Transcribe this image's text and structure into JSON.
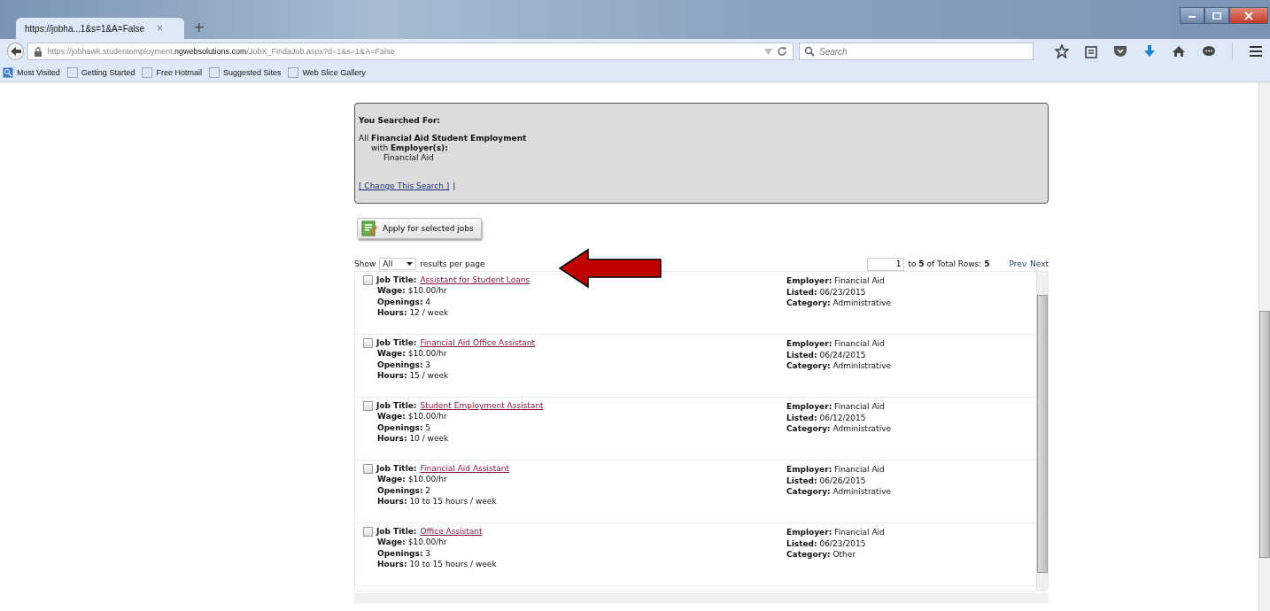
{
  "browser": {
    "tab_title": "https://jobha...1&s=1&A=False",
    "tab_close": "×",
    "new_tab": "+",
    "url": "https://jobhawk.studentemployment.**ngwebsolutions.com**/JobX_FindaJob.aspx?d=1&s=1&A=False",
    "search": {
      "placeholder": "Search"
    },
    "bookmarks": [
      "Most Visited",
      "Getting Started",
      "Free Hotmail",
      "Suggested Sites",
      "Web Slice Gallery"
    ]
  },
  "summary": {
    "heading": "You Searched For:",
    "line_1": "All **Financial Aid Student Employment**",
    "line_2": "with **Employer(s):**",
    "line_3": "Financial Aid",
    "change_link": "[ Change This Search ]",
    "separator": "|"
  },
  "apply_button": "Apply for selected jobs",
  "results_per_page": {
    "show": "Show",
    "value": "All",
    "suffix": "results per page"
  },
  "pager": {
    "start": "1",
    "range": "to **5** of Total Rows: **5**",
    "prev": "Prev",
    "next": "Next"
  },
  "jobs": [
    {
      "checked": false,
      "title_label": "Job Title:",
      "title": "Assistant for Student Loans",
      "left": [
        "**Wage:** $10.00/hr",
        "**Openings:** 4",
        "**Hours:** 12 / week"
      ],
      "right": [
        "**Employer:** Financial Aid",
        "**Listed:** 06/23/2015",
        "**Category:** Administrative"
      ]
    },
    {
      "checked": false,
      "title_label": "Job Title:",
      "title": "Financial Aid Office Assistant",
      "left": [
        "**Wage:** $10.00/hr",
        "**Openings:** 3",
        "**Hours:** 15 / week"
      ],
      "right": [
        "**Employer:** Financial Aid",
        "**Listed:** 06/24/2015",
        "**Category:** Administrative"
      ]
    },
    {
      "checked": false,
      "title_label": "Job Title:",
      "title": "Student Employment Assistant",
      "left": [
        "**Wage:** $10.00/hr",
        "**Openings:** 5",
        "**Hours:** 10 / week"
      ],
      "right": [
        "**Employer:** Financial Aid",
        "**Listed:** 06/12/2015",
        "**Category:** Administrative"
      ]
    },
    {
      "checked": false,
      "title_label": "Job Title:",
      "title": "Financial Aid Assistant",
      "left": [
        "**Wage:** $10.00/hr",
        "**Openings:** 2",
        "**Hours:** 10 to 15 hours / week"
      ],
      "right": [
        "**Employer:** Financial Aid",
        "**Listed:** 06/26/2015",
        "**Category:** Administrative"
      ]
    },
    {
      "checked": false,
      "title_label": "Job Title:",
      "title": "Office Assistant",
      "left": [
        "**Wage:** $10.00/hr",
        "**Openings:** 3",
        "**Hours:** 10 to 15 hours / week"
      ],
      "right": [
        "**Employer:** Financial Aid",
        "**Listed:** 06/23/2015",
        "**Category:** Other"
      ]
    }
  ]
}
